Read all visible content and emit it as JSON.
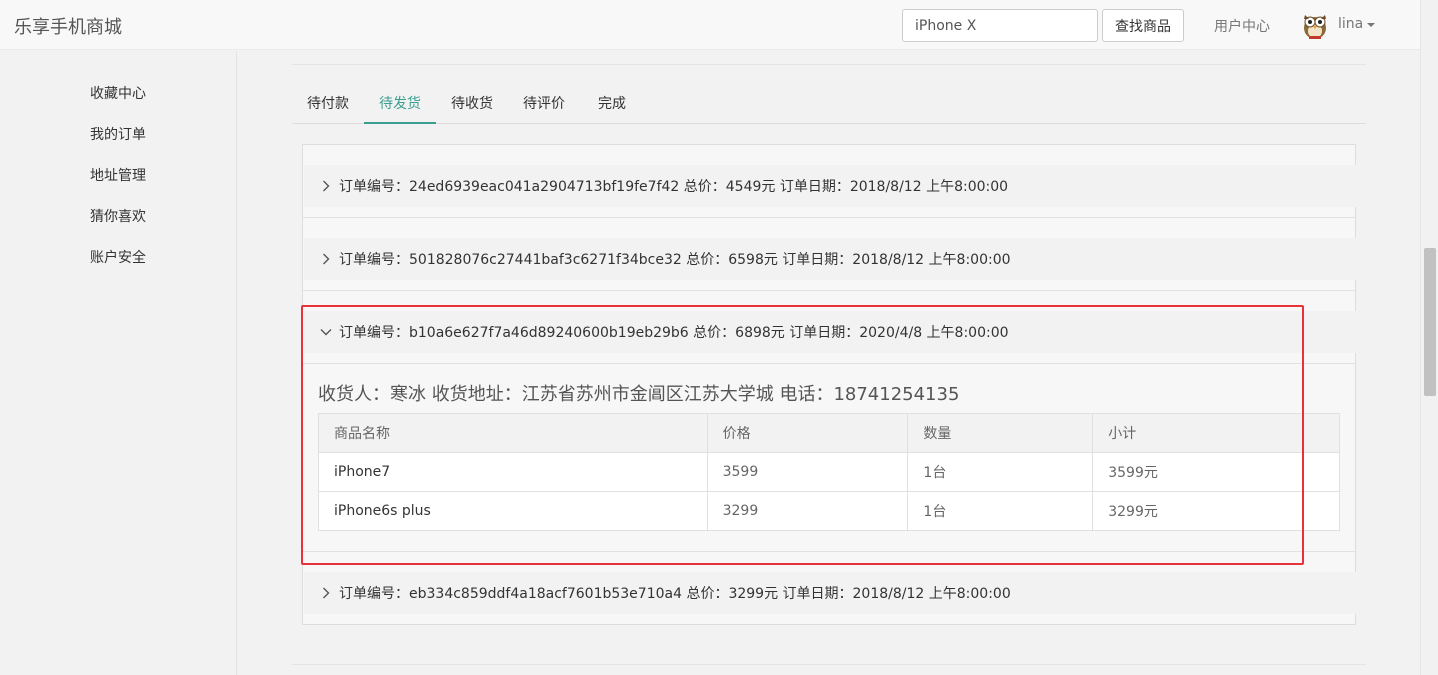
{
  "navbar": {
    "brand": "乐享手机商城",
    "search_value": "iPhone X",
    "search_button": "查找商品",
    "user_center": "用户中心",
    "username": "lina"
  },
  "sidebar": {
    "items": [
      {
        "label": "收藏中心"
      },
      {
        "label": "我的订单"
      },
      {
        "label": "地址管理"
      },
      {
        "label": "猜你喜欢"
      },
      {
        "label": "账户安全"
      }
    ]
  },
  "tabs": [
    {
      "label": "待付款",
      "active": false
    },
    {
      "label": "待发货",
      "active": true
    },
    {
      "label": "待收货",
      "active": false
    },
    {
      "label": "待评价",
      "active": false
    },
    {
      "label": "完成",
      "active": false
    }
  ],
  "orders": [
    {
      "summary": "订单编号：24ed6939eac041a2904713bf19fe7f42  总价：4549元 订单日期：2018/8/12 上午8:00:00",
      "expanded": false
    },
    {
      "summary": "订单编号：501828076c27441baf3c6271f34bce32  总价：6598元 订单日期：2018/8/12 上午8:00:00",
      "expanded": false
    },
    {
      "summary": "订单编号：b10a6e627f7a46d89240600b19eb29b6  总价：6898元 订单日期：2020/4/8 上午8:00:00",
      "expanded": true
    },
    {
      "summary": "订单编号：eb334c859ddf4a18acf7601b53e710a4  总价：3299元 订单日期：2018/8/12 上午8:00:00",
      "expanded": false
    }
  ],
  "expanded_order": {
    "receiver": "收货人：寒冰  收货地址：江苏省苏州市金阊区江苏大学城 电话：18741254135",
    "columns": [
      "商品名称",
      "价格",
      "数量",
      "小计"
    ],
    "rows": [
      [
        "iPhone7",
        "3599",
        "1台",
        "3599元"
      ],
      [
        "iPhone6s plus",
        "3299",
        "1台",
        "3299元"
      ]
    ]
  },
  "colors": {
    "accent": "#3c9e8f",
    "highlight_border": "#e8323a"
  }
}
